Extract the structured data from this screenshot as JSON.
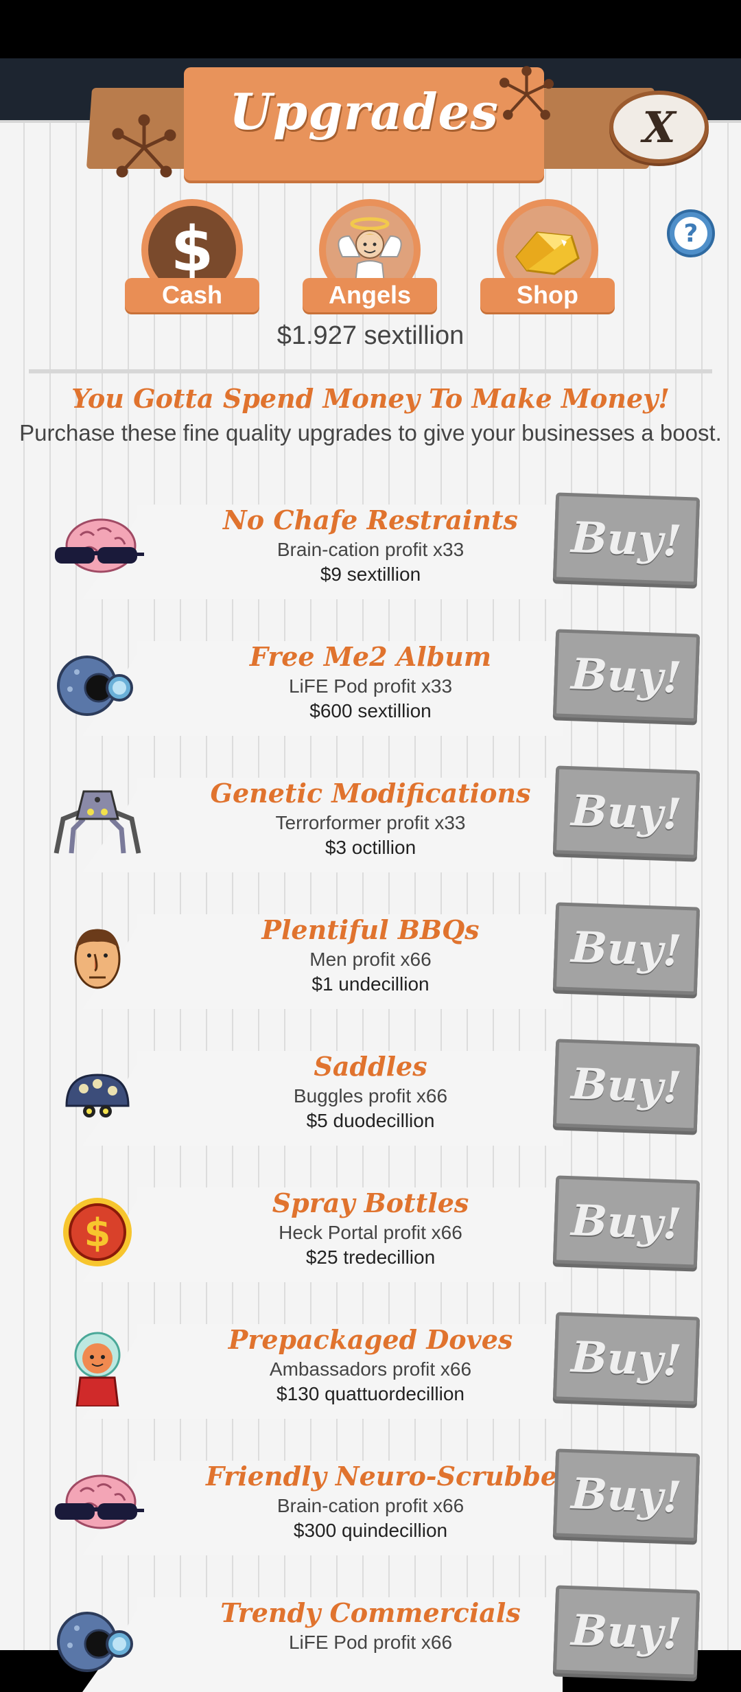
{
  "header": {
    "title": "Upgrades",
    "close_label": "X"
  },
  "tabs": [
    {
      "label": "Cash",
      "icon": "dollar-icon"
    },
    {
      "label": "Angels",
      "icon": "angel-icon"
    },
    {
      "label": "Shop",
      "icon": "gold-icon"
    }
  ],
  "help_label": "?",
  "balance": "$1.927 sextillion",
  "slogan": "You Gotta Spend Money To Make Money!",
  "subtitle": "Purchase these fine quality upgrades to give your businesses a boost.",
  "upgrades": [
    {
      "name": "No Chafe Restraints",
      "desc": "Brain-cation profit x33",
      "cost": "$9 sextillion",
      "icon": "brain-icon",
      "buy": "Buy!"
    },
    {
      "name": "Free Me2 Album",
      "desc": "LiFE Pod profit x33",
      "cost": "$600 sextillion",
      "icon": "pod-icon",
      "buy": "Buy!"
    },
    {
      "name": "Genetic Modifications",
      "desc": "Terrorformer profit x33",
      "cost": "$3 octillion",
      "icon": "spider-robot-icon",
      "buy": "Buy!"
    },
    {
      "name": "Plentiful BBQs",
      "desc": "Men profit x66",
      "cost": "$1 undecillion",
      "icon": "man-face-icon",
      "buy": "Buy!"
    },
    {
      "name": "Saddles",
      "desc": "Buggles profit x66",
      "cost": "$5 duodecillion",
      "icon": "buggle-icon",
      "buy": "Buy!"
    },
    {
      "name": "Spray Bottles",
      "desc": "Heck Portal profit x66",
      "cost": "$25 tredecillion",
      "icon": "portal-icon",
      "buy": "Buy!"
    },
    {
      "name": "Prepackaged Doves",
      "desc": "Ambassadors profit x66",
      "cost": "$130 quattuordecillion",
      "icon": "ambassador-icon",
      "buy": "Buy!"
    },
    {
      "name": "Friendly Neuro-Scrubbers",
      "desc": "Brain-cation profit x66",
      "cost": "$300 quindecillion",
      "icon": "brain-icon",
      "buy": "Buy!"
    },
    {
      "name": "Trendy Commercials",
      "desc": "LiFE Pod profit x66",
      "cost": "",
      "icon": "pod-icon",
      "buy": "Buy!"
    }
  ]
}
